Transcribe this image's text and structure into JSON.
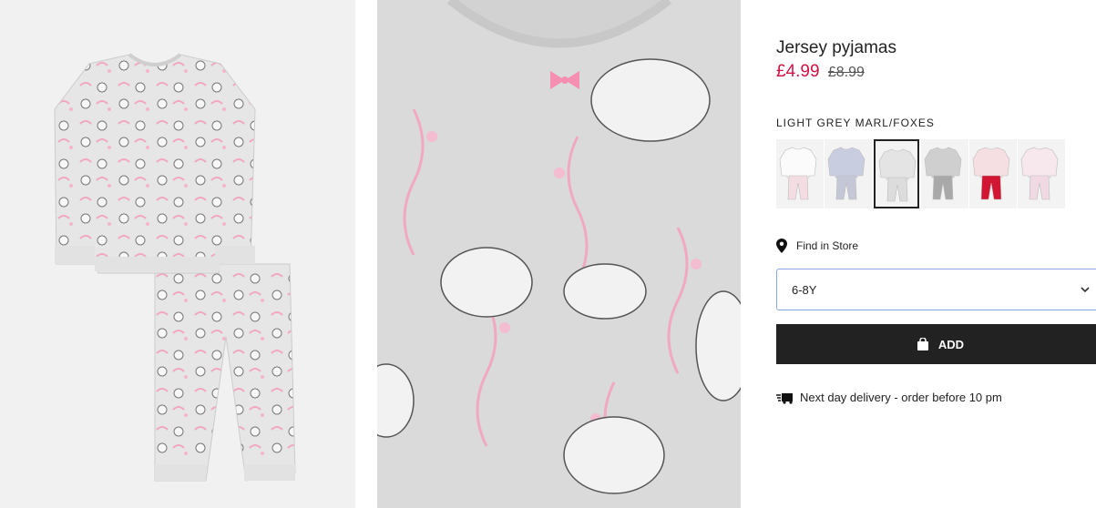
{
  "product": {
    "title": "Jersey pyjamas",
    "price_now": "£4.99",
    "price_old": "£8.99",
    "color_name": "LIGHT GREY MARL/FOXES",
    "swatches": [
      {
        "top": "#fbfbfb",
        "bottom": "#f3dde3"
      },
      {
        "top": "#c9cde0",
        "bottom": "#c4c7d6"
      },
      {
        "top": "#e4e4e4",
        "bottom": "#dcdcdc"
      },
      {
        "top": "#cfcfcf",
        "bottom": "#a9a9a9"
      },
      {
        "top": "#f6dfe3",
        "bottom": "#d21532"
      },
      {
        "top": "#f7e8ee",
        "bottom": "#f0d9e2"
      }
    ],
    "active_swatch": 2,
    "find_in_store": "Find in Store",
    "size_selected": "6-8Y",
    "add_label": "ADD",
    "delivery_text": "Next day delivery - order before 10 pm"
  },
  "colors": {
    "price_sale": "#d01345",
    "button_bg": "#222222",
    "select_border": "#8aa8e8"
  },
  "icons": [
    "location-pin-icon",
    "chevron-down-icon",
    "shopping-bag-icon",
    "delivery-truck-icon"
  ]
}
